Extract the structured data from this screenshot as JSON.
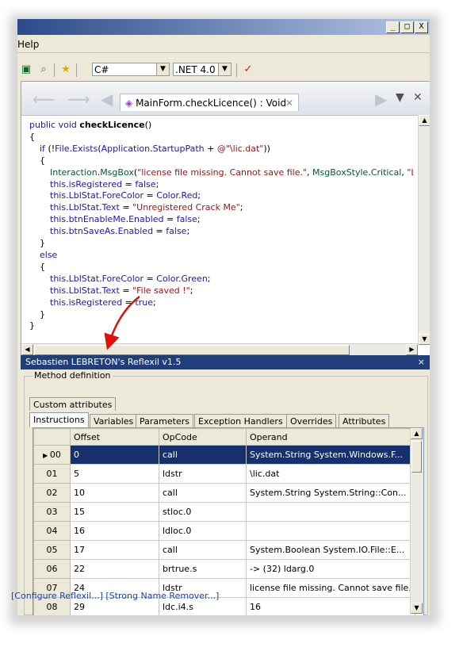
{
  "window": {
    "min": "_",
    "max": "□",
    "close": "X"
  },
  "menu": {
    "help": "Help"
  },
  "toolbar": {
    "language": "C#",
    "framework": ".NET 4.0"
  },
  "editor": {
    "tab_title": "MainForm.checkLicence() : Void",
    "code_lines": [
      {
        "indent": 0,
        "parts": [
          [
            "kw",
            "public void "
          ],
          [
            "b",
            "checkLicence"
          ],
          [
            "n",
            "()"
          ]
        ]
      },
      {
        "indent": 0,
        "parts": [
          [
            "n",
            "{"
          ]
        ]
      },
      {
        "indent": 1,
        "parts": [
          [
            "kw",
            "if "
          ],
          [
            "n",
            "(!"
          ],
          [
            "ty",
            "File"
          ],
          [
            "n",
            "."
          ],
          [
            "ty",
            "Exists"
          ],
          [
            "n",
            "("
          ],
          [
            "ty",
            "Application"
          ],
          [
            "n",
            "."
          ],
          [
            "ty",
            "StartupPath"
          ],
          [
            "n",
            " + "
          ],
          [
            "str",
            "@\"\\lic.dat\""
          ],
          [
            "n",
            "))"
          ]
        ]
      },
      {
        "indent": 1,
        "parts": [
          [
            "n",
            "{"
          ]
        ]
      },
      {
        "indent": 2,
        "parts": [
          [
            "grn",
            "Interaction"
          ],
          [
            "n",
            "."
          ],
          [
            "grn",
            "MsgBox"
          ],
          [
            "n",
            "("
          ],
          [
            "str",
            "\"license file missing. Cannot save file.\""
          ],
          [
            "n",
            ", "
          ],
          [
            "grn",
            "MsgBoxStyle"
          ],
          [
            "n",
            "."
          ],
          [
            "grn",
            "Critical"
          ],
          [
            "n",
            ", "
          ],
          [
            "str",
            "\"Licen"
          ]
        ]
      },
      {
        "indent": 2,
        "parts": [
          [
            "kw",
            "this"
          ],
          [
            "n",
            "."
          ],
          [
            "ty",
            "isRegistered"
          ],
          [
            "n",
            " = "
          ],
          [
            "kw",
            "false"
          ],
          [
            "n",
            ";"
          ]
        ]
      },
      {
        "indent": 2,
        "parts": [
          [
            "kw",
            "this"
          ],
          [
            "n",
            "."
          ],
          [
            "ty",
            "LblStat"
          ],
          [
            "n",
            "."
          ],
          [
            "ty",
            "ForeColor"
          ],
          [
            "n",
            " = "
          ],
          [
            "ty",
            "Color"
          ],
          [
            "n",
            "."
          ],
          [
            "ty",
            "Red"
          ],
          [
            "n",
            ";"
          ]
        ]
      },
      {
        "indent": 2,
        "parts": [
          [
            "kw",
            "this"
          ],
          [
            "n",
            "."
          ],
          [
            "ty",
            "LblStat"
          ],
          [
            "n",
            "."
          ],
          [
            "ty",
            "Text"
          ],
          [
            "n",
            " = "
          ],
          [
            "str",
            "\"Unregistered Crack Me\""
          ],
          [
            "n",
            ";"
          ]
        ]
      },
      {
        "indent": 2,
        "parts": [
          [
            "kw",
            "this"
          ],
          [
            "n",
            "."
          ],
          [
            "ty",
            "btnEnableMe"
          ],
          [
            "n",
            "."
          ],
          [
            "ty",
            "Enabled"
          ],
          [
            "n",
            " = "
          ],
          [
            "kw",
            "false"
          ],
          [
            "n",
            ";"
          ]
        ]
      },
      {
        "indent": 2,
        "parts": [
          [
            "kw",
            "this"
          ],
          [
            "n",
            "."
          ],
          [
            "ty",
            "btnSaveAs"
          ],
          [
            "n",
            "."
          ],
          [
            "ty",
            "Enabled"
          ],
          [
            "n",
            " = "
          ],
          [
            "kw",
            "false"
          ],
          [
            "n",
            ";"
          ]
        ]
      },
      {
        "indent": 1,
        "parts": [
          [
            "n",
            "}"
          ]
        ]
      },
      {
        "indent": 1,
        "parts": [
          [
            "kw",
            "else"
          ]
        ]
      },
      {
        "indent": 1,
        "parts": [
          [
            "n",
            "{"
          ]
        ]
      },
      {
        "indent": 2,
        "parts": [
          [
            "kw",
            "this"
          ],
          [
            "n",
            "."
          ],
          [
            "ty",
            "LblStat"
          ],
          [
            "n",
            "."
          ],
          [
            "ty",
            "ForeColor"
          ],
          [
            "n",
            " = "
          ],
          [
            "ty",
            "Color"
          ],
          [
            "n",
            "."
          ],
          [
            "ty",
            "Green"
          ],
          [
            "n",
            ";"
          ]
        ]
      },
      {
        "indent": 2,
        "parts": [
          [
            "kw",
            "this"
          ],
          [
            "n",
            "."
          ],
          [
            "ty",
            "LblStat"
          ],
          [
            "n",
            "."
          ],
          [
            "ty",
            "Text"
          ],
          [
            "n",
            " = "
          ],
          [
            "str",
            "\"File saved !\""
          ],
          [
            "n",
            ";"
          ]
        ]
      },
      {
        "indent": 2,
        "parts": [
          [
            "kw",
            "this"
          ],
          [
            "n",
            "."
          ],
          [
            "ty",
            "isRegistered"
          ],
          [
            "n",
            " = "
          ],
          [
            "kw",
            "true"
          ],
          [
            "n",
            ";"
          ]
        ]
      },
      {
        "indent": 1,
        "parts": [
          [
            "n",
            "}"
          ]
        ]
      },
      {
        "indent": 0,
        "parts": [
          [
            "n",
            "}"
          ]
        ]
      }
    ]
  },
  "reflexil": {
    "title": "Sebastien LEBRETON's Reflexil v1.5",
    "close": "×",
    "group_label": "Method definition",
    "top_tab": "Custom attributes",
    "tabs": [
      "Instructions",
      "Variables",
      "Parameters",
      "Exception Handlers",
      "Overrides",
      "Attributes"
    ],
    "columns": [
      "Offset",
      "OpCode",
      "Operand"
    ],
    "rows": [
      {
        "index": "00",
        "offset": "0",
        "opcode": "call",
        "operand": "System.String System.Windows.F..."
      },
      {
        "index": "01",
        "offset": "5",
        "opcode": "ldstr",
        "operand": "\\lic.dat"
      },
      {
        "index": "02",
        "offset": "10",
        "opcode": "call",
        "operand": "System.String System.String::Con..."
      },
      {
        "index": "03",
        "offset": "15",
        "opcode": "stloc.0",
        "operand": ""
      },
      {
        "index": "04",
        "offset": "16",
        "opcode": "ldloc.0",
        "operand": ""
      },
      {
        "index": "05",
        "offset": "17",
        "opcode": "call",
        "operand": "System.Boolean System.IO.File::E..."
      },
      {
        "index": "06",
        "offset": "22",
        "opcode": "brtrue.s",
        "operand": "-> (32) ldarg.0"
      },
      {
        "index": "07",
        "offset": "24",
        "opcode": "ldstr",
        "operand": "license file missing. Cannot save file."
      },
      {
        "index": "08",
        "offset": "29",
        "opcode": "ldc.i4.s",
        "operand": "16"
      }
    ],
    "footer": "[Configure Reflexil...] [Strong Name Remover...]"
  },
  "colors": {
    "selection": "#15306d",
    "annotation_arrow": "#e01010",
    "reflexil_title": "#1f3e7a"
  }
}
